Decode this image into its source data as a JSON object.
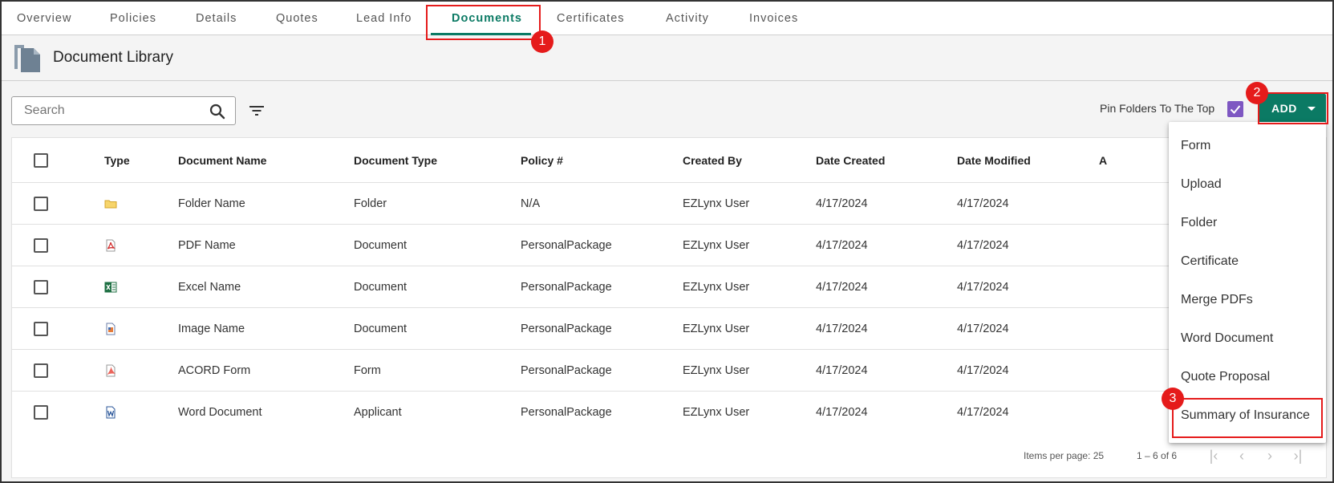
{
  "tabs": [
    {
      "label": "Overview"
    },
    {
      "label": "Policies"
    },
    {
      "label": "Details"
    },
    {
      "label": "Quotes"
    },
    {
      "label": "Lead Info"
    },
    {
      "label": "Documents"
    },
    {
      "label": "Certificates"
    },
    {
      "label": "Activity"
    },
    {
      "label": "Invoices"
    }
  ],
  "active_tab": "Documents",
  "header": {
    "title": "Document Library"
  },
  "toolbar": {
    "search_placeholder": "Search",
    "pin_label": "Pin Folders To The Top",
    "pin_checked": true,
    "add_label": "ADD"
  },
  "table": {
    "columns": [
      "Type",
      "Document Name",
      "Document Type",
      "Policy #",
      "Created By",
      "Date Created",
      "Date Modified",
      "A"
    ],
    "rows": [
      {
        "icon": "folder-icon",
        "name": "Folder Name",
        "type": "Folder",
        "policy": "N/A",
        "created_by": "EZLynx User",
        "date_created": "4/17/2024",
        "date_modified": "4/17/2024"
      },
      {
        "icon": "pdf-icon",
        "name": "PDF Name",
        "type": "Document",
        "policy": "PersonalPackage",
        "created_by": "EZLynx User",
        "date_created": "4/17/2024",
        "date_modified": "4/17/2024"
      },
      {
        "icon": "excel-icon",
        "name": "Excel Name",
        "type": "Document",
        "policy": "PersonalPackage",
        "created_by": "EZLynx User",
        "date_created": "4/17/2024",
        "date_modified": "4/17/2024"
      },
      {
        "icon": "image-icon",
        "name": "Image Name",
        "type": "Document",
        "policy": "PersonalPackage",
        "created_by": "EZLynx User",
        "date_created": "4/17/2024",
        "date_modified": "4/17/2024"
      },
      {
        "icon": "acord-form-icon",
        "name": "ACORD Form",
        "type": "Form",
        "policy": "PersonalPackage",
        "created_by": "EZLynx User",
        "date_created": "4/17/2024",
        "date_modified": "4/17/2024"
      },
      {
        "icon": "word-icon",
        "name": "Word Document",
        "type": "Applicant",
        "policy": "PersonalPackage",
        "created_by": "EZLynx User",
        "date_created": "4/17/2024",
        "date_modified": "4/17/2024"
      }
    ],
    "footer": {
      "items_per_page": "Items per page: 25",
      "range": "1 – 6 of 6"
    }
  },
  "add_menu": {
    "items": [
      "Form",
      "Upload",
      "Folder",
      "Certificate",
      "Merge PDFs",
      "Word Document",
      "Quote Proposal",
      "Summary of Insurance"
    ]
  },
  "annotations": {
    "step1": "1",
    "step2": "2",
    "step3": "3"
  },
  "colors": {
    "accent": "#0b7a64",
    "highlight": "#e51b1b",
    "checkbox": "#7e57c2"
  }
}
